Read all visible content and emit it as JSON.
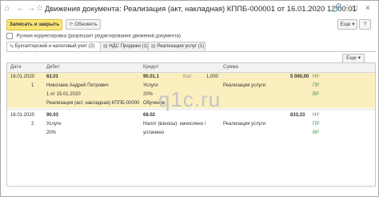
{
  "window": {
    "title": "Движения документа: Реализация (акт, накладная) КППБ-000001 от 16.01.2020 12:00:01",
    "icons": [
      "home-icon",
      "back-arrow-icon",
      "forward-arrow-icon",
      "star-icon",
      "link-icon",
      "more-icon",
      "minimize-icon",
      "maximize-icon",
      "close-icon"
    ]
  },
  "toolbar": {
    "save_close": "Записать и закрыть",
    "refresh": "Обновить",
    "more": "Еще",
    "help": "?"
  },
  "manual_edit": {
    "label": "Ручная корректировка (разрешает редактирование движений документа)"
  },
  "tabs": [
    {
      "label": "Бухгалтерский и налоговый учет (2)"
    },
    {
      "label": "НДС Продажи (1)"
    },
    {
      "label": "Реализация услуг (1)"
    }
  ],
  "grid": {
    "more": "Еще",
    "headers": {
      "date": "Дата",
      "debit": "Дебет",
      "credit": "Кредит",
      "sum": "Сумма"
    },
    "entries": [
      {
        "rows": [
          {
            "date": "16.01.2020",
            "debit": "62.01",
            "credit": "90.01.1",
            "kt_label": "Кол.",
            "kt_qty": "1,000",
            "sum": "5 000,00",
            "tag": "НУ"
          },
          {
            "date": "1",
            "debit": "Николаев Андрей Петрович",
            "credit": "Услуги",
            "sum": "Реализация услуги",
            "tag": "ПР"
          },
          {
            "debit": "1 от 15.01.2020",
            "credit": "20%",
            "tag": "ВР"
          },
          {
            "debit": "Реализация (акт, накладная) КППБ-00000",
            "credit": "Обучение"
          }
        ]
      },
      {
        "rows": [
          {
            "date": "16.01.2020",
            "debit": "90.03",
            "credit": "68.02",
            "sum": "833,33",
            "tag": "НУ"
          },
          {
            "date": "2",
            "debit": "Услуги",
            "credit": "Налог (взносы): начислено /",
            "sum": "Реализация услуги",
            "tag": "ПР"
          },
          {
            "debit": "20%",
            "credit": "уплачено",
            "tag": "ВР"
          }
        ]
      }
    ]
  },
  "watermark": "q1c.ru"
}
